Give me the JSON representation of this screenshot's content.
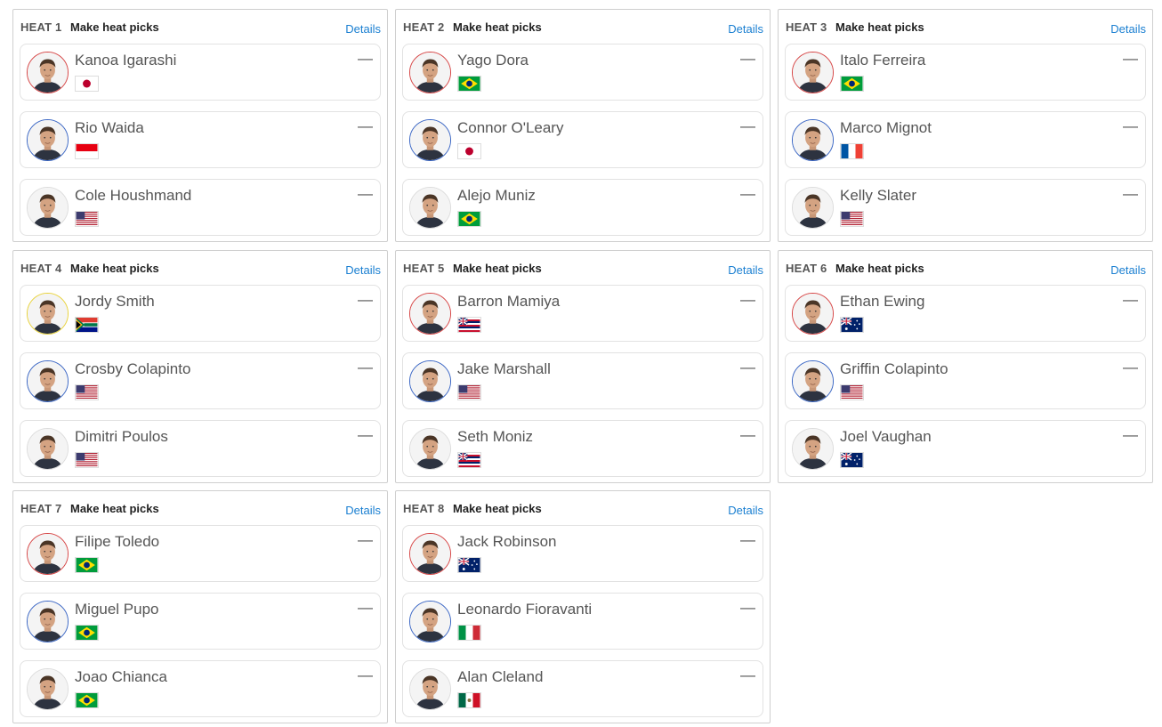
{
  "detail_label": "Details",
  "picks_label": "Make heat picks",
  "heats": [
    {
      "label": "HEAT 1",
      "athletes": [
        {
          "name": "Kanoa Igarashi",
          "country": "JPN",
          "ring_color": "#d64545",
          "score": "—"
        },
        {
          "name": "Rio Waida",
          "country": "IDN",
          "ring_color": "#3a66c4",
          "score": "—"
        },
        {
          "name": "Cole Houshmand",
          "country": "USA",
          "ring_color": "#dcdcdc",
          "score": "—"
        }
      ]
    },
    {
      "label": "HEAT 2",
      "athletes": [
        {
          "name": "Yago Dora",
          "country": "BRA",
          "ring_color": "#d64545",
          "score": "—"
        },
        {
          "name": "Connor O'Leary",
          "country": "JPN",
          "ring_color": "#3a66c4",
          "score": "—"
        },
        {
          "name": "Alejo Muniz",
          "country": "BRA",
          "ring_color": "#dcdcdc",
          "score": "—"
        }
      ]
    },
    {
      "label": "HEAT 3",
      "athletes": [
        {
          "name": "Italo Ferreira",
          "country": "BRA",
          "ring_color": "#d64545",
          "score": "—"
        },
        {
          "name": "Marco Mignot",
          "country": "FRA",
          "ring_color": "#3a66c4",
          "score": "—"
        },
        {
          "name": "Kelly Slater",
          "country": "USA",
          "ring_color": "#dcdcdc",
          "score": "—"
        }
      ]
    },
    {
      "label": "HEAT 4",
      "athletes": [
        {
          "name": "Jordy Smith",
          "country": "ZAF",
          "ring_color": "#e8d23a",
          "score": "—"
        },
        {
          "name": "Crosby Colapinto",
          "country": "USA",
          "ring_color": "#3a66c4",
          "score": "—"
        },
        {
          "name": "Dimitri Poulos",
          "country": "USA",
          "ring_color": "#dcdcdc",
          "score": "—"
        }
      ]
    },
    {
      "label": "HEAT 5",
      "athletes": [
        {
          "name": "Barron Mamiya",
          "country": "HAW",
          "ring_color": "#d64545",
          "score": "—"
        },
        {
          "name": "Jake Marshall",
          "country": "USA",
          "ring_color": "#3a66c4",
          "score": "—"
        },
        {
          "name": "Seth Moniz",
          "country": "HAW",
          "ring_color": "#dcdcdc",
          "score": "—"
        }
      ]
    },
    {
      "label": "HEAT 6",
      "athletes": [
        {
          "name": "Ethan Ewing",
          "country": "AUS",
          "ring_color": "#d64545",
          "score": "—"
        },
        {
          "name": "Griffin Colapinto",
          "country": "USA",
          "ring_color": "#3a66c4",
          "score": "—"
        },
        {
          "name": "Joel Vaughan",
          "country": "AUS",
          "ring_color": "#dcdcdc",
          "score": "—"
        }
      ]
    },
    {
      "label": "HEAT 7",
      "athletes": [
        {
          "name": "Filipe Toledo",
          "country": "BRA",
          "ring_color": "#d64545",
          "score": "—"
        },
        {
          "name": "Miguel Pupo",
          "country": "BRA",
          "ring_color": "#3a66c4",
          "score": "—"
        },
        {
          "name": "Joao Chianca",
          "country": "BRA",
          "ring_color": "#dcdcdc",
          "score": "—"
        }
      ]
    },
    {
      "label": "HEAT 8",
      "athletes": [
        {
          "name": "Jack Robinson",
          "country": "AUS",
          "ring_color": "#d64545",
          "score": "—"
        },
        {
          "name": "Leonardo Fioravanti",
          "country": "ITA",
          "ring_color": "#3a66c4",
          "score": "—"
        },
        {
          "name": "Alan Cleland",
          "country": "MEX",
          "ring_color": "#dcdcdc",
          "score": "—"
        }
      ]
    }
  ]
}
